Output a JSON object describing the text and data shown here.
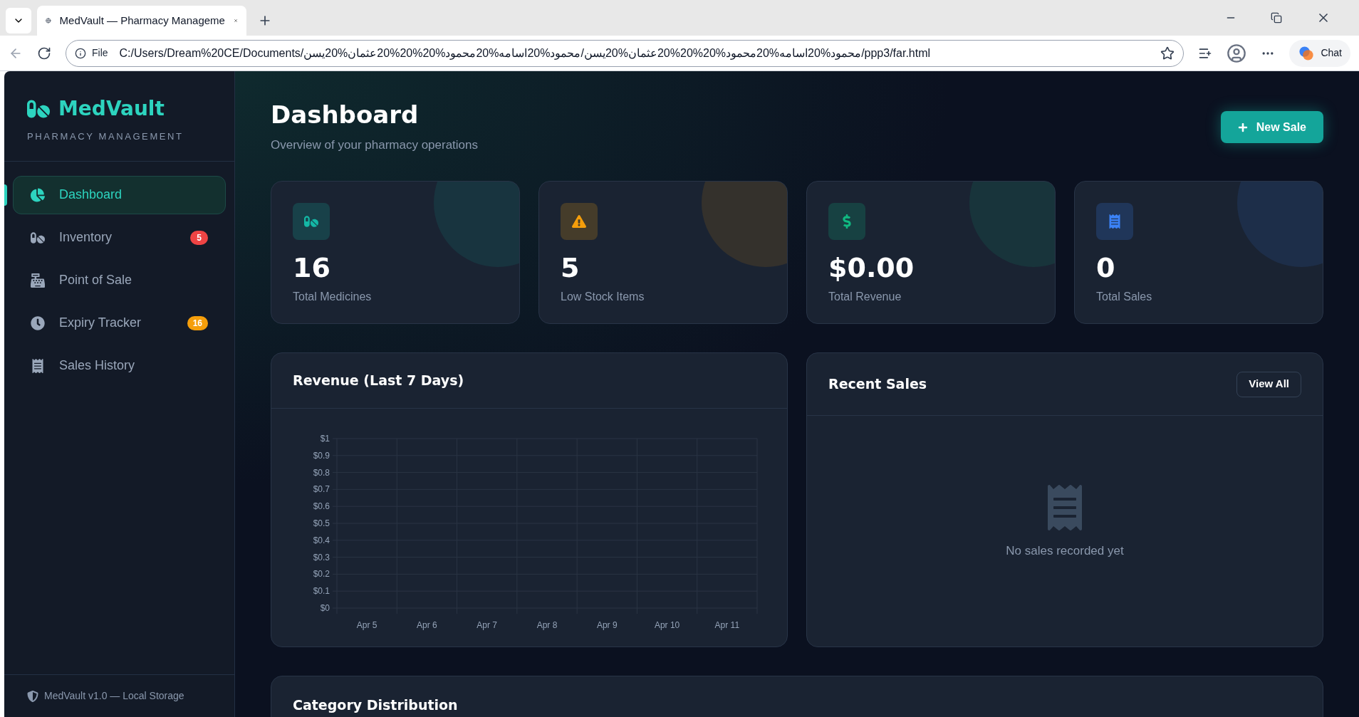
{
  "browser": {
    "tab_title": "MedVault — Pharmacy Manageme",
    "address_prefix": "File",
    "url": "C:/Users/Dream%20CE/Documents/محمود%20اسامه%20محمود%20%20%20عثمان%20يسن/محمود%20اسامه%20محمود%20%20%20عثمان%20يسن/ppp3/far.html",
    "chat_label": "Chat"
  },
  "brand": {
    "name": "MedVault",
    "tagline": "PHARMACY MANAGEMENT"
  },
  "sidebar": {
    "items": [
      {
        "kind": "dashboard",
        "label": "Dashboard",
        "selected": true
      },
      {
        "kind": "inventory",
        "label": "Inventory",
        "selected": false,
        "badge": "5",
        "color": "#ef4444"
      },
      {
        "kind": "pos",
        "label": "Point of Sale",
        "selected": false
      },
      {
        "kind": "expiry",
        "label": "Expiry Tracker",
        "selected": false,
        "badge": "16",
        "color": "#f59e0b"
      },
      {
        "kind": "history",
        "label": "Sales History",
        "selected": false
      }
    ],
    "footer": "MedVault v1.0 — Local Storage"
  },
  "header": {
    "title": "Dashboard",
    "subtitle": "Overview of your pharmacy operations",
    "button": "New Sale"
  },
  "stats": [
    {
      "kind": "pills",
      "value": "16",
      "label": "Total Medicines",
      "color": "#14b8a6"
    },
    {
      "kind": "warning",
      "value": "5",
      "label": "Low Stock Items",
      "color": "#f59e0b"
    },
    {
      "kind": "dollar",
      "value": "$0.00",
      "label": "Total Revenue",
      "color": "#10b981"
    },
    {
      "kind": "receipt",
      "value": "0",
      "label": "Total Sales",
      "color": "#3b82f6"
    }
  ],
  "revenue": {
    "title": "Revenue (Last 7 Days)",
    "chart_data": {
      "type": "bar",
      "categories": [
        "Apr 5",
        "Apr 6",
        "Apr 7",
        "Apr 8",
        "Apr 9",
        "Apr 10",
        "Apr 11"
      ],
      "grid": true,
      "ylim": [
        0,
        1
      ],
      "yticks": [
        {
          "value": 0,
          "label": "$0"
        },
        {
          "value": 0.1,
          "label": "$0.1"
        },
        {
          "value": 0.2,
          "label": "$0.2"
        },
        {
          "value": 0.3,
          "label": "$0.3"
        },
        {
          "value": 0.4,
          "label": "$0.4"
        },
        {
          "value": 0.5,
          "label": "$0.5"
        },
        {
          "value": 0.6,
          "label": "$0.6"
        },
        {
          "value": 0.7,
          "label": "$0.7"
        },
        {
          "value": 0.8,
          "label": "$0.8"
        },
        {
          "value": 0.9,
          "label": "$0.9"
        },
        {
          "value": 1,
          "label": "$1"
        }
      ]
    }
  },
  "recent_sales": {
    "title": "Recent Sales",
    "button": "View All",
    "empty_text": "No sales recorded yet"
  },
  "category": {
    "title": "Category Distribution"
  }
}
